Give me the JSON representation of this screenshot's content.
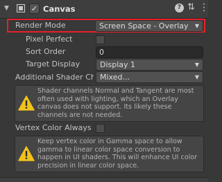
{
  "component": {
    "title": "Canvas",
    "enabled": true
  },
  "header": {
    "foldout_icon": "triangle-down-icon",
    "component_icon": "canvas-icon",
    "help_icon": "help-icon",
    "help_glyph": "?",
    "preset_icon": "preset-icon",
    "preset_glyph": "⇅",
    "menu_icon": "kebab-menu-icon",
    "menu_glyph": "⋮",
    "check_glyph": "✓"
  },
  "fields": {
    "render_mode": {
      "label": "Render Mode",
      "value": "Screen Space - Overlay"
    },
    "pixel_perfect": {
      "label": "Pixel Perfect",
      "checked": false
    },
    "sort_order": {
      "label": "Sort Order",
      "value": "0"
    },
    "target_display": {
      "label": "Target Display",
      "value": "Display 1"
    },
    "additional_shader_channels": {
      "label": "Additional Shader Ch",
      "value": "Mixed..."
    },
    "vertex_color_always": {
      "label": "Vertex Color Always",
      "checked": false
    }
  },
  "help_boxes": [
    {
      "icon": "warning-icon",
      "text": "Shader channels Normal and Tangent are most often used with lighting, which an Overlay canvas does not support. Its likely these channels are not needed."
    },
    {
      "icon": "warning-icon",
      "text": "Keep vertex color in Gamma space to allow gamma to linear color space conversion to happen in UI shaders. This will enhance UI color precision in linear color space."
    }
  ],
  "colors": {
    "highlight": "#e8202a",
    "warning": "#f2c21b",
    "panel": "#383838"
  },
  "dropdown_caret": "▼"
}
